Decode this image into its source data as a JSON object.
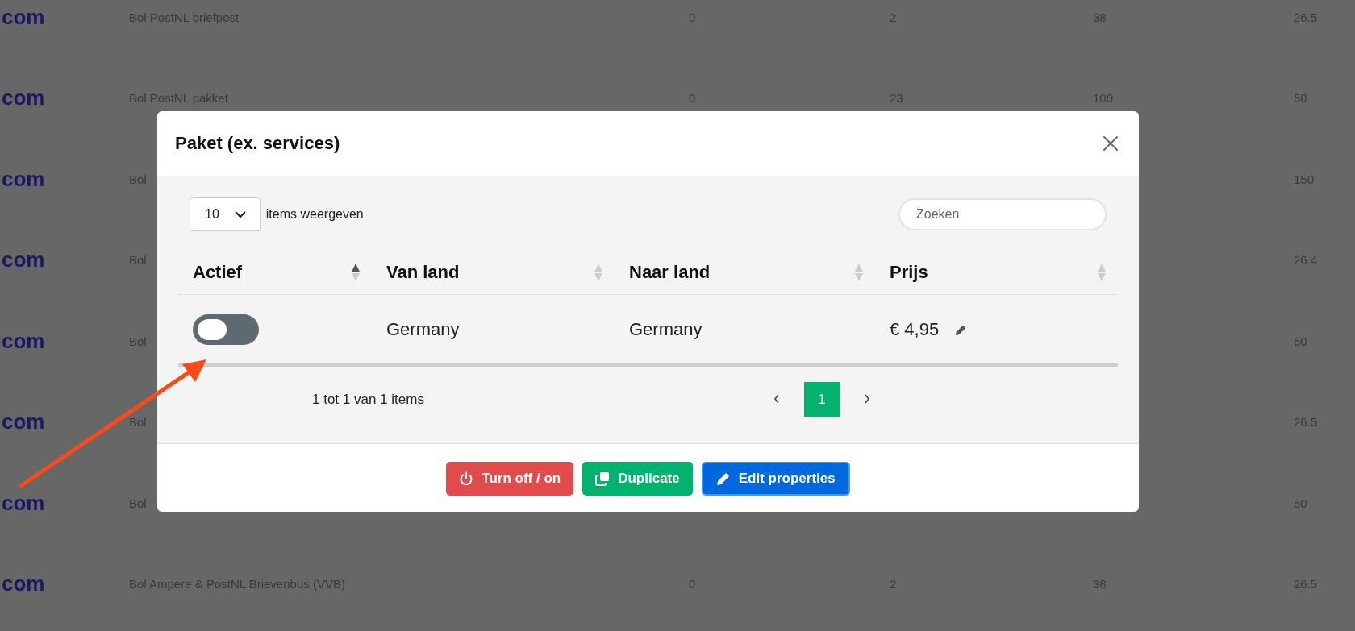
{
  "background_table": {
    "rows": [
      {
        "logo": "com",
        "name": "Bol PostNL briefpost",
        "column_3": "0",
        "column_4": "2",
        "column_5": "38",
        "column_6": "26.5"
      },
      {
        "logo": "com",
        "name": "Bol PostNL pakket",
        "column_3": "0",
        "column_4": "23",
        "column_5": "100",
        "column_6": "50"
      },
      {
        "logo": "com",
        "name": "Bol",
        "column_6": "150"
      },
      {
        "logo": "com",
        "name": "Bol",
        "column_6": "26.4"
      },
      {
        "logo": "com",
        "name": "Bol",
        "column_6": "50"
      },
      {
        "logo": "com",
        "name": "Bol",
        "column_6": "26.5"
      },
      {
        "logo": "com",
        "name": "Bol",
        "column_6": "50"
      },
      {
        "logo": "com",
        "name": "Bol Ampere & PostNL Brievenbus (VVB)",
        "column_3": "0",
        "column_4": "2",
        "column_5": "38",
        "column_6": "26.5"
      }
    ]
  },
  "dialog": {
    "title": "Paket (ex. services)",
    "page_size": "10",
    "page_size_label": "items weergeven",
    "search": {
      "placeholder": "Zoeken"
    },
    "columns": [
      {
        "label": "Actief",
        "sorted": true
      },
      {
        "label": "Van land",
        "sorted": false
      },
      {
        "label": "Naar land",
        "sorted": false
      },
      {
        "label": "Prijs",
        "sorted": false
      }
    ],
    "rows": [
      {
        "active": false,
        "from": "Germany",
        "to": "Germany",
        "price": "€ 4,95"
      }
    ],
    "summary": "1 tot 1 van 1 items",
    "pages": [
      {
        "label": "1",
        "selected": true
      }
    ],
    "buttons": [
      {
        "kind": "power",
        "label": "Turn off / on"
      },
      {
        "kind": "duplicate",
        "label": "Duplicate"
      },
      {
        "kind": "edit",
        "label": "Edit properties"
      }
    ]
  }
}
